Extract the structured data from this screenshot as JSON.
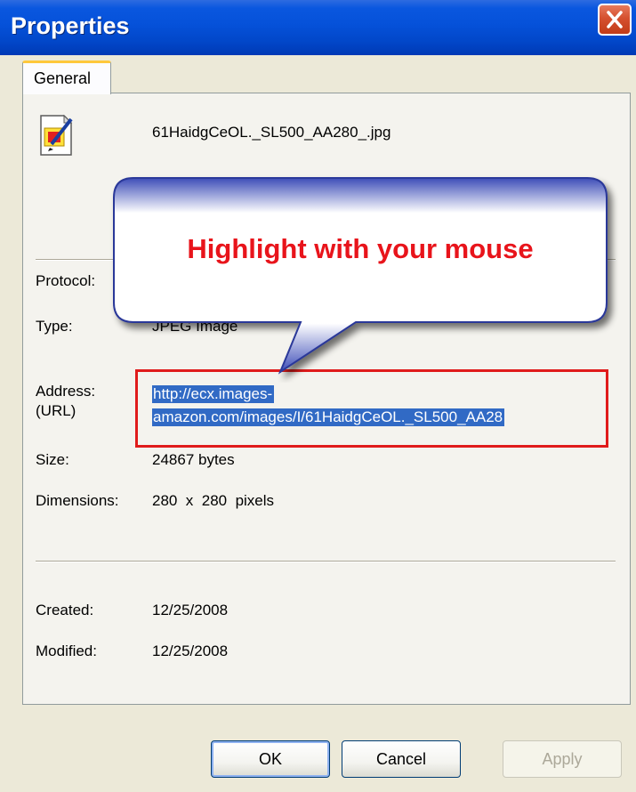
{
  "window": {
    "title": "Properties",
    "close_icon": "close-icon"
  },
  "tabs": [
    {
      "label": "General",
      "active": true
    }
  ],
  "file": {
    "icon": "jpeg-file-icon",
    "name": "61HaidgCeOL._SL500_AA280_.jpg"
  },
  "labels": {
    "protocol": "Protocol:",
    "type": "Type:",
    "address_line1": "Address:",
    "address_line2": "(URL)",
    "size": "Size:",
    "dimensions": "Dimensions:",
    "created": "Created:",
    "modified": "Modified:"
  },
  "values": {
    "type": "JPEG Image",
    "address_line1": "http://ecx.images-",
    "address_line2": "amazon.com/images/I/61HaidgCeOL._SL500_AA28",
    "size": "24867 bytes",
    "dimensions": "280  x  280  pixels",
    "created": "12/25/2008",
    "modified": "12/25/2008"
  },
  "callout": {
    "text": "Highlight with your mouse"
  },
  "buttons": {
    "ok": "OK",
    "cancel": "Cancel",
    "apply": "Apply"
  },
  "colors": {
    "titlebar": "#0551d9",
    "selection": "#316ac5",
    "highlight_box": "#e01b1b",
    "callout_text": "#e8141b",
    "tab_accent": "#ffc83c"
  }
}
